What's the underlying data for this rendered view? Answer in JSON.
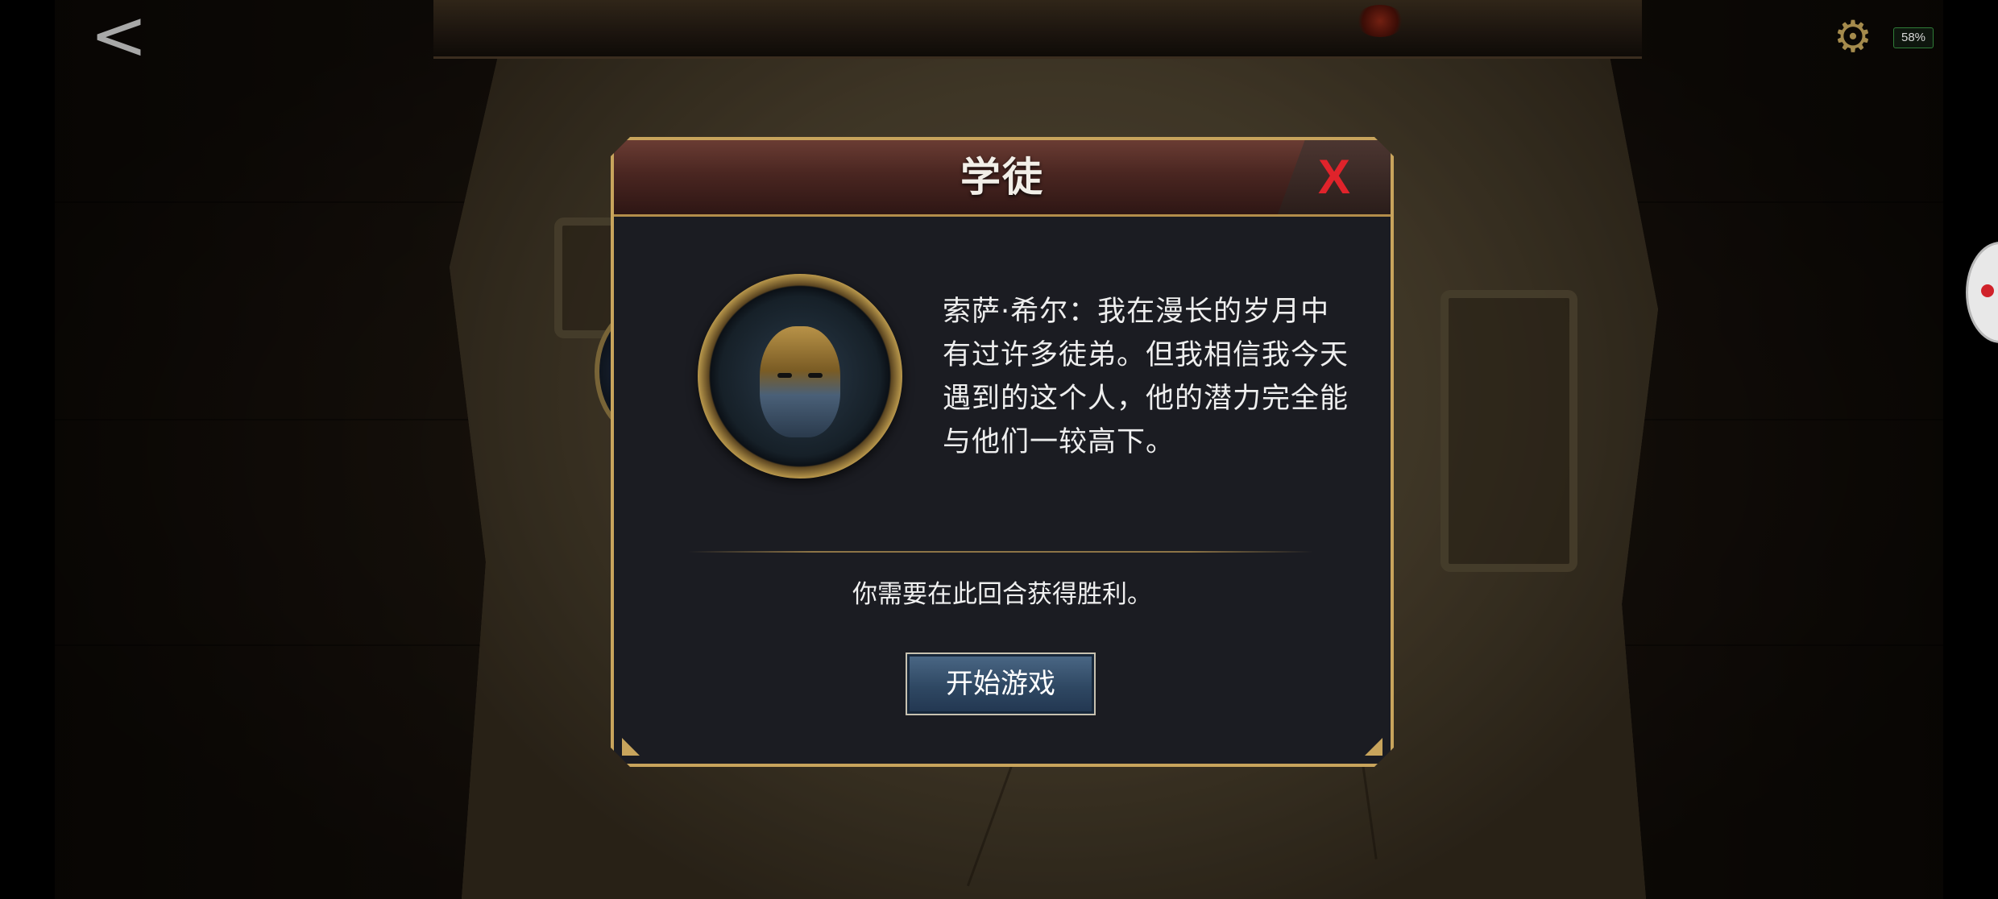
{
  "top_bar": {
    "back_glyph": "<",
    "settings_glyph": "⚙",
    "battery_label": "58%",
    "battery_level": 0.58
  },
  "dialog": {
    "title": "学徒",
    "close_label": "X",
    "speaker_quote": "索萨·希尔：我在漫长的岁月中有过许多徒弟。但我相信我今天遇到的这个人，他的潜力完全能与他们一较高下。",
    "objective": "你需要在此回合获得胜利。",
    "start_button_label": "开始游戏"
  },
  "colors": {
    "close_x": "#e0232b",
    "gold_frame": "#c8a45c",
    "button_blue": "#2f4863",
    "header_red": "#4a2621"
  },
  "icons": {
    "back": "back-arrow-icon",
    "settings": "gear-icon",
    "close": "close-icon",
    "portrait": "character-portrait"
  }
}
